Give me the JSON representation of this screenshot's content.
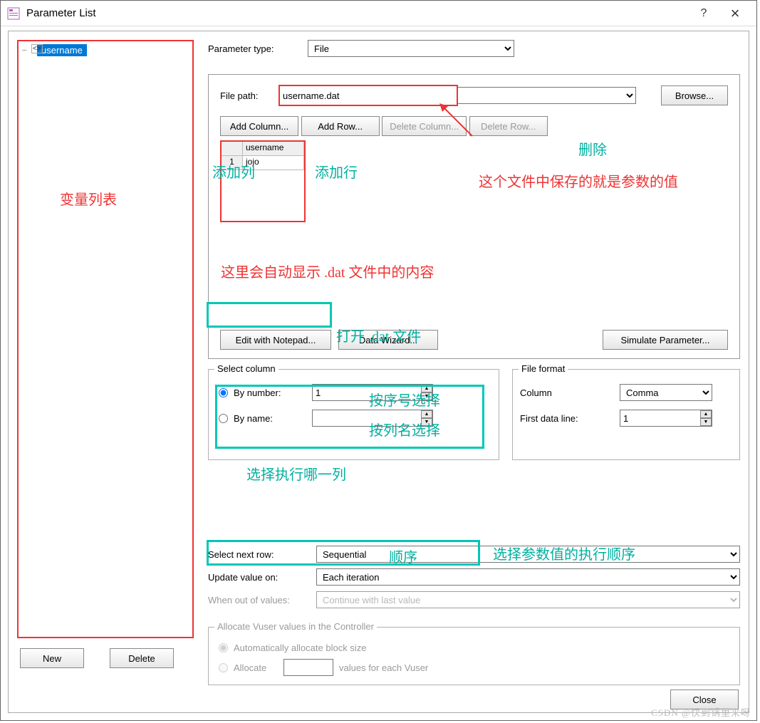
{
  "window": {
    "title": "Parameter List",
    "help_icon": "?",
    "close_icon": "×"
  },
  "tree": {
    "selected": "username"
  },
  "param_type": {
    "label": "Parameter type:",
    "value": "File"
  },
  "file": {
    "path_label": "File path:",
    "path_value": "username.dat",
    "browse": "Browse...",
    "add_column": "Add Column...",
    "add_row": "Add Row...",
    "delete_column": "Delete Column...",
    "delete_row": "Delete Row...",
    "edit_notepad": "Edit with Notepad...",
    "data_wizard": "Data Wizard...",
    "simulate": "Simulate Parameter...",
    "table": {
      "header": "username",
      "row_num": "1",
      "cell": "jojo"
    }
  },
  "select_column": {
    "title": "Select column",
    "by_number": "By number:",
    "by_number_value": "1",
    "by_name": "By name:",
    "by_name_value": ""
  },
  "file_format": {
    "title": "File format",
    "column_label": "Column",
    "column_value": "Comma",
    "first_line_label": "First data line:",
    "first_line_value": "1"
  },
  "run": {
    "select_next_row_label": "Select next row:",
    "select_next_row_value": "Sequential",
    "update_label": "Update value on:",
    "update_value": "Each iteration",
    "when_out_label": "When out of values:",
    "when_out_value": "Continue with last value"
  },
  "allocate": {
    "title": "Allocate Vuser values in the Controller",
    "auto": "Automatically allocate block size",
    "alloc": "Allocate",
    "suffix": "values for each Vuser"
  },
  "buttons": {
    "new": "New",
    "delete": "Delete",
    "close": "Close"
  },
  "annotations": {
    "var_list": "变量列表",
    "delete_cn": "删除",
    "add_col_cn": "添加列",
    "add_row_cn": "添加行",
    "file_content": "这个文件中保存的就是参数的值",
    "auto_show": "这里会自动显示 .dat 文件中的内容",
    "open_dat": "打开 .dat 文件",
    "by_num_cn": "按序号选择",
    "by_name_cn": "按列名选择",
    "select_col_cn": "选择执行哪一列",
    "seq_cn": "顺序",
    "order_cn": "选择参数值的执行顺序"
  },
  "watermark": "CSDN @快到锅里来呀"
}
